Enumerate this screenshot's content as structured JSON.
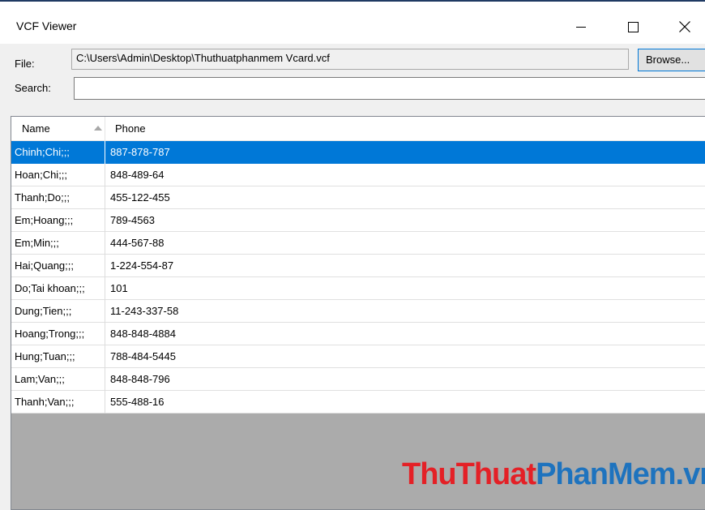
{
  "window": {
    "title": "VCF Viewer",
    "controls": {
      "minimize": "minimize-icon",
      "maximize": "maximize-icon",
      "close": "close-icon"
    }
  },
  "form": {
    "file_label": "File:",
    "file_path": "C:\\Users\\Admin\\Desktop\\Thuthuatphanmem Vcard.vcf",
    "browse_label": "Browse...",
    "search_label": "Search:",
    "search_value": ""
  },
  "table": {
    "columns": [
      "Name",
      "Phone"
    ],
    "sort_column": "Name",
    "sort_direction": "ascending",
    "selected_index": 0,
    "rows": [
      {
        "name": "Chinh;Chi;;;",
        "phone": "887-878-787"
      },
      {
        "name": "Hoan;Chi;;;",
        "phone": "848-489-64"
      },
      {
        "name": "Thanh;Do;;;",
        "phone": "455-122-455"
      },
      {
        "name": "Em;Hoang;;;",
        "phone": "789-4563"
      },
      {
        "name": "Em;Min;;;",
        "phone": "444-567-88"
      },
      {
        "name": "Hai;Quang;;;",
        "phone": "1-224-554-87"
      },
      {
        "name": "Do;Tai khoan;;;",
        "phone": "101"
      },
      {
        "name": "Dung;Tien;;;",
        "phone": "11-243-337-58"
      },
      {
        "name": "Hoang;Trong;;;",
        "phone": "848-848-4884"
      },
      {
        "name": "Hung;Tuan;;;",
        "phone": "788-484-5445"
      },
      {
        "name": "Lam;Van;;;",
        "phone": "848-848-796"
      },
      {
        "name": "Thanh;Van;;;",
        "phone": "555-488-16"
      }
    ]
  },
  "watermark": {
    "part1": "ThuThuat",
    "part2": "PhanMem.vn"
  },
  "colors": {
    "selection": "#0078d7",
    "empty_area": "#ababab",
    "watermark_red": "#e42026",
    "watermark_blue": "#1e73be"
  }
}
